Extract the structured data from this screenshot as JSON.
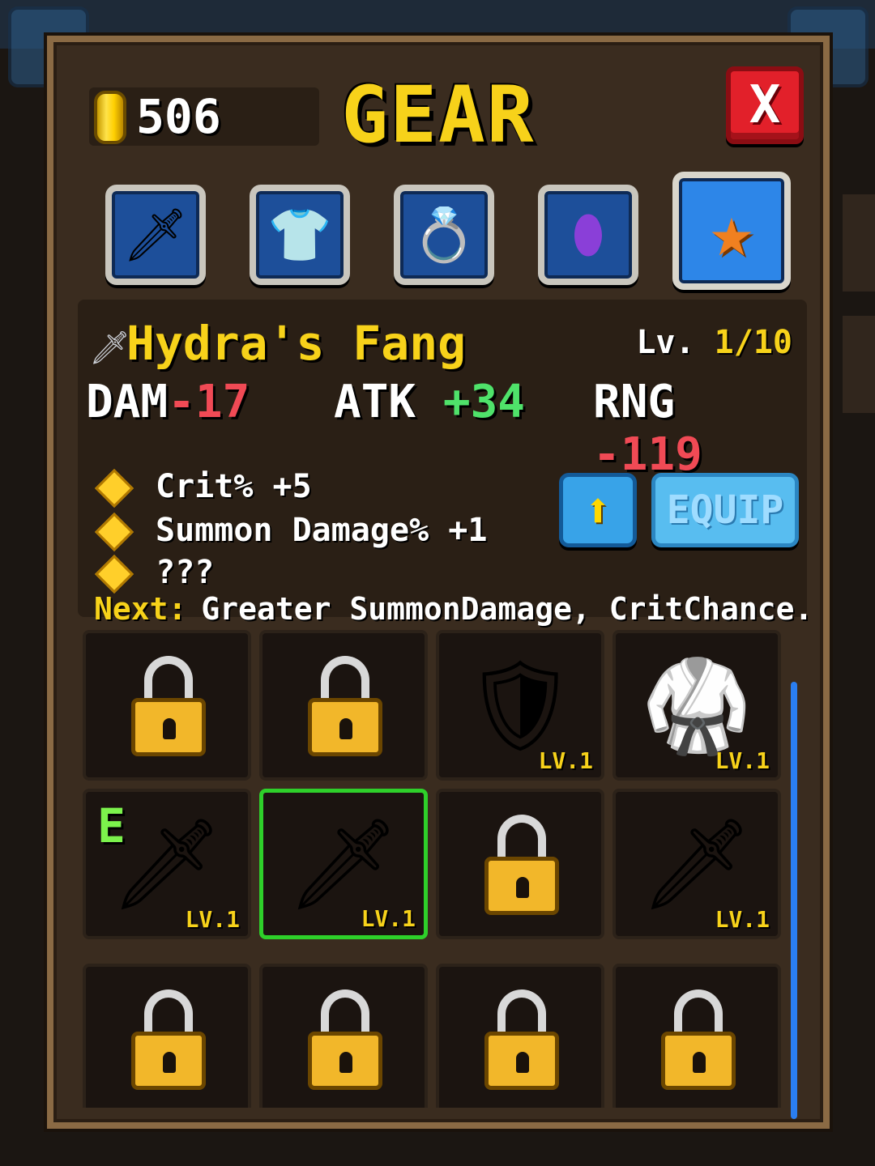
{
  "currency": {
    "amount": "506",
    "icon": "gold-coin-icon"
  },
  "title": "GEAR",
  "close": {
    "label": "X"
  },
  "tabs": [
    {
      "name": "weapon",
      "icon": "sword-icon",
      "glyph": "🗡",
      "active": false
    },
    {
      "name": "armor",
      "icon": "armor-icon",
      "glyph": "👕",
      "active": false
    },
    {
      "name": "ring",
      "icon": "ring-icon",
      "glyph": "💍",
      "active": false
    },
    {
      "name": "gem",
      "icon": "gem-icon",
      "glyph": "⬮",
      "active": false
    },
    {
      "name": "star",
      "icon": "star-icon",
      "glyph": "★",
      "active": true
    }
  ],
  "item": {
    "name": "Hydra's Fang",
    "level_prefix": "Lv.",
    "level": "1/10",
    "stats": [
      {
        "label": "DAM",
        "value": "-17"
      },
      {
        "label": "ATK",
        "value": "+34"
      },
      {
        "label": "RNG",
        "value": "-119"
      }
    ],
    "perks": [
      "Crit% +5",
      "Summon Damage% +1",
      "???"
    ],
    "next_label": "Next:",
    "next_text": "Greater SummonDamage, CritChance."
  },
  "buttons": {
    "upgrade": "⬆",
    "equip": "EQUIP"
  },
  "grid": {
    "level_label": "LV.1",
    "equipped_label": "E",
    "cells": [
      {
        "locked": true
      },
      {
        "locked": true
      },
      {
        "locked": false,
        "art": "🛡",
        "lv": true
      },
      {
        "locked": false,
        "art": "🥋",
        "lv": true
      },
      {
        "locked": false,
        "art": "🗡",
        "lv": true,
        "equipped": true
      },
      {
        "locked": false,
        "art": "🗡",
        "lv": true,
        "selected": true
      },
      {
        "locked": true
      },
      {
        "locked": false,
        "art": "🗡",
        "lv": true
      },
      {
        "locked": true
      },
      {
        "locked": true
      },
      {
        "locked": true
      },
      {
        "locked": true
      }
    ]
  },
  "colors": {
    "accent": "#f7d21a",
    "negative": "#f04a55",
    "positive": "#4fe26a",
    "selected": "#2ed02a"
  }
}
